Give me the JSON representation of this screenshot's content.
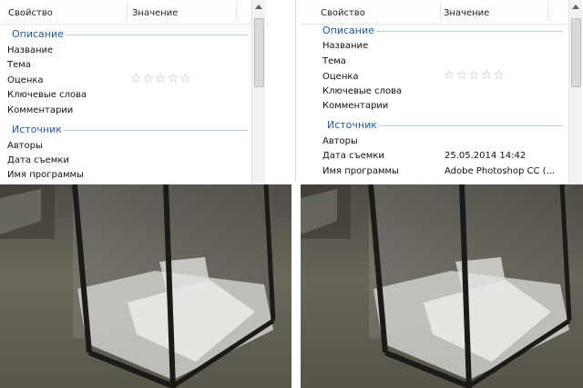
{
  "left_panel": {
    "header": {
      "property": "Свойство",
      "value": "Значение"
    },
    "sections": {
      "description": {
        "title": "Описание",
        "rows": [
          {
            "label": "Название",
            "value": ""
          },
          {
            "label": "Тема",
            "value": ""
          },
          {
            "label": "Оценка",
            "value": "☆☆☆☆☆"
          },
          {
            "label": "Ключевые слова",
            "value": ""
          },
          {
            "label": "Комментарии",
            "value": ""
          }
        ]
      },
      "source": {
        "title": "Источник",
        "rows": [
          {
            "label": "Авторы",
            "value": ""
          },
          {
            "label": "Дата съемки",
            "value": ""
          },
          {
            "label": "Имя программы",
            "value": ""
          }
        ]
      }
    }
  },
  "right_panel": {
    "header": {
      "property": "Свойство",
      "value": "Значение"
    },
    "sections": {
      "description": {
        "title": "Описание",
        "rows": [
          {
            "label": "Название",
            "value": ""
          },
          {
            "label": "Тема",
            "value": ""
          },
          {
            "label": "Оценка",
            "value": "☆☆☆☆☆"
          },
          {
            "label": "Ключевые слова",
            "value": ""
          },
          {
            "label": "Комментарии",
            "value": ""
          }
        ]
      },
      "source": {
        "title": "Источник",
        "rows": [
          {
            "label": "Авторы",
            "value": ""
          },
          {
            "label": "Дата съемки",
            "value": "25.05.2014 14:42"
          },
          {
            "label": "Имя программы",
            "value": "Adobe Photoshop CC (..."
          }
        ]
      }
    }
  },
  "colors": {
    "section_title": "#1a5aa8",
    "section_line": "#b7cde4",
    "star": "#b8b8b8"
  },
  "icons": [
    "star-rating-icon",
    "scroll-up-arrow-icon"
  ]
}
